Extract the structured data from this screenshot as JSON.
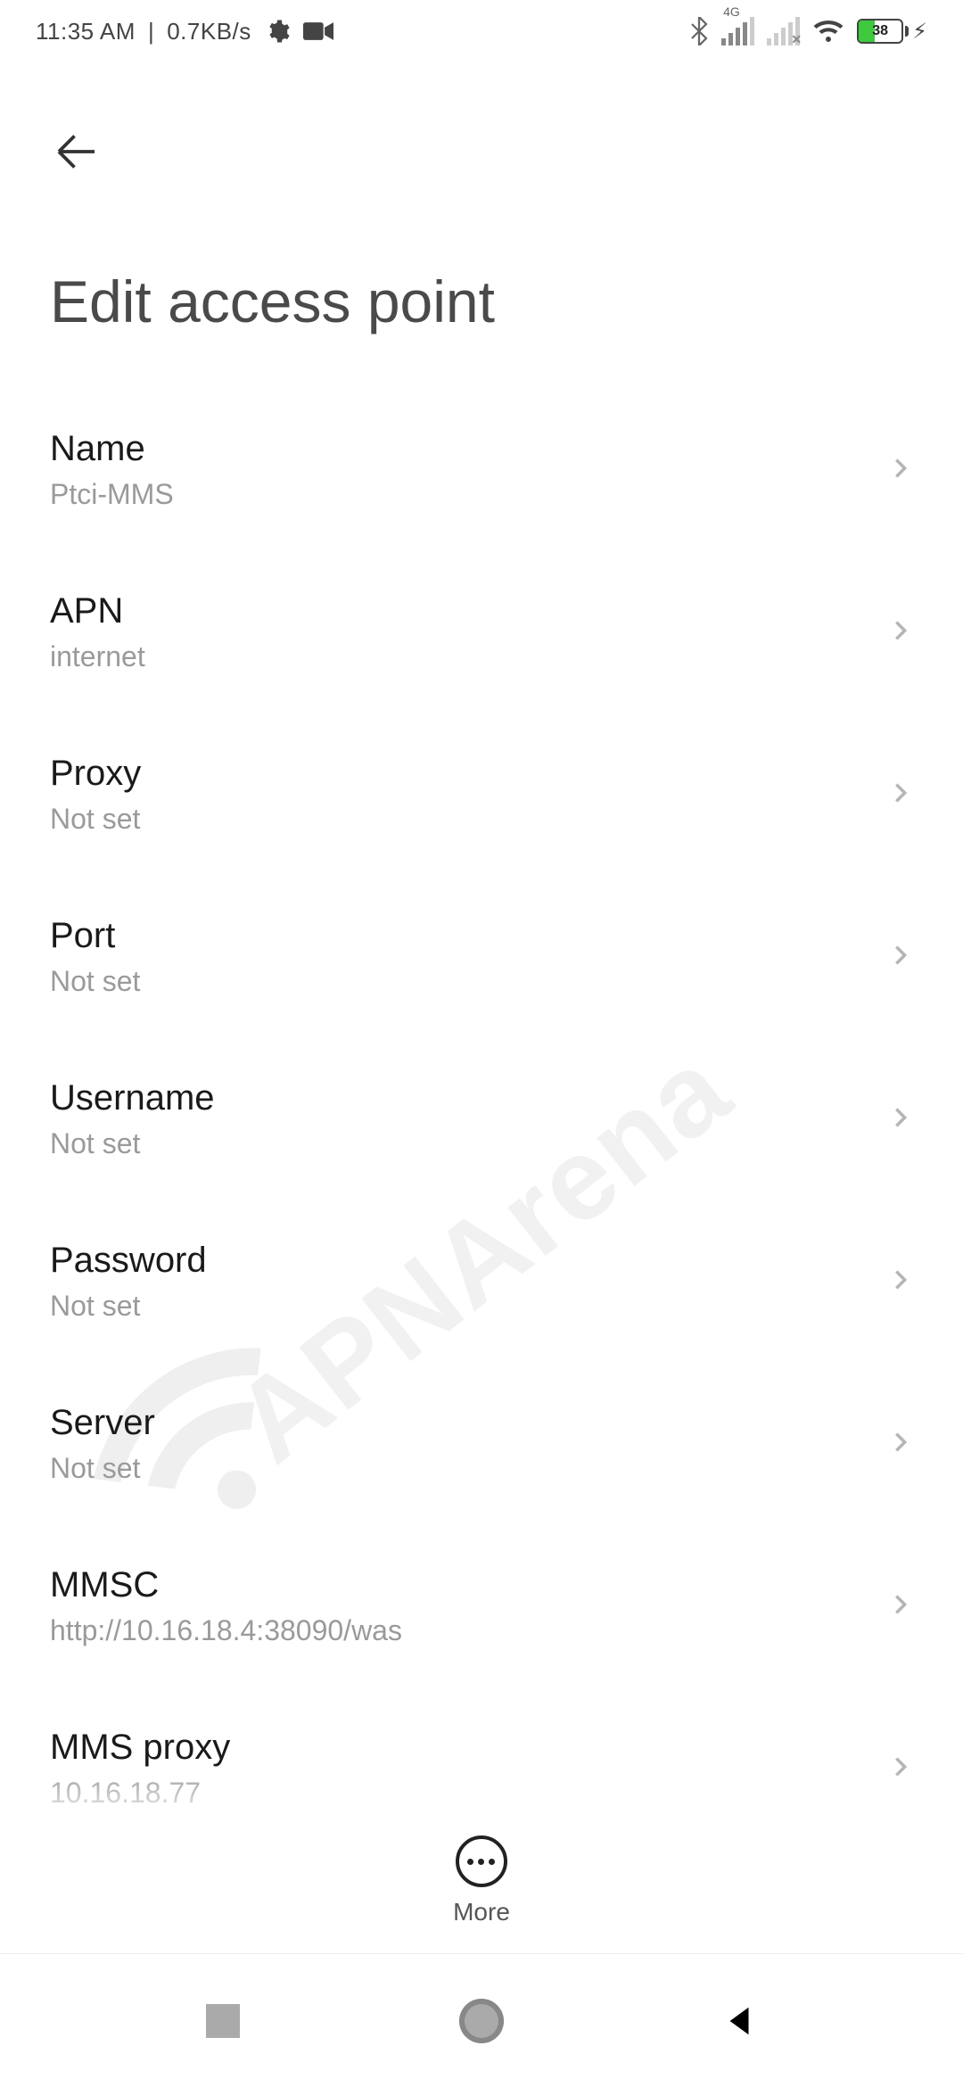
{
  "status": {
    "time": "11:35 AM",
    "speed": "0.7KB/s",
    "network_label": "4G",
    "battery_pct": "38"
  },
  "header": {
    "title": "Edit access point"
  },
  "fields": [
    {
      "label": "Name",
      "value": "Ptci-MMS"
    },
    {
      "label": "APN",
      "value": "internet"
    },
    {
      "label": "Proxy",
      "value": "Not set"
    },
    {
      "label": "Port",
      "value": "Not set"
    },
    {
      "label": "Username",
      "value": "Not set"
    },
    {
      "label": "Password",
      "value": "Not set"
    },
    {
      "label": "Server",
      "value": "Not set"
    },
    {
      "label": "MMSC",
      "value": "http://10.16.18.4:38090/was"
    },
    {
      "label": "MMS proxy",
      "value": "10.16.18.77"
    }
  ],
  "bottom": {
    "more": "More"
  },
  "watermark": "APNArena"
}
